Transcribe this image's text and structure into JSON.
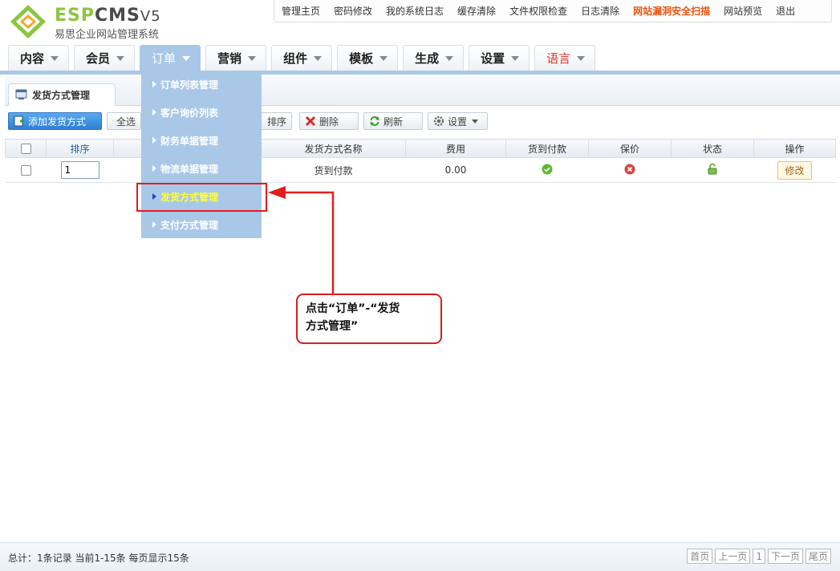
{
  "brand": {
    "name_part1": "ESP",
    "name_part2": "CMS",
    "version": "V5",
    "subtitle": "易思企业网站管理系统"
  },
  "topnav": [
    "管理主页",
    "密码修改",
    "我的系统日志",
    "缓存清除",
    "文件权限检查",
    "日志清除",
    "网站漏洞安全扫描",
    "网站预览",
    "退出"
  ],
  "mainnav": [
    "内容",
    "会员",
    "订单",
    "营销",
    "组件",
    "模板",
    "生成",
    "设置",
    "语言"
  ],
  "dropdown": [
    "订单列表管理",
    "客户询价列表",
    "财务单据管理",
    "物流单据管理",
    "发货方式管理",
    "支付方式管理"
  ],
  "page_tab": "发货方式管理",
  "toolbar": {
    "add": "添加发货方式",
    "select_all": "全选",
    "sort": "排序",
    "delete": "删除",
    "refresh": "刷新",
    "settings": "设置"
  },
  "table": {
    "headers": [
      "排序",
      "发货方式名称",
      "费用",
      "货到付款",
      "保价",
      "状态",
      "操作"
    ],
    "rows": [
      {
        "sort": "1",
        "name": "货到付款",
        "fee": "0.00",
        "edit": "修改"
      }
    ]
  },
  "callout": {
    "line1": "点击“订单”-“发货",
    "line2": "方式管理”"
  },
  "footer": {
    "summary": "总计：1条记录 当前1-15条 每页显示15条",
    "pager": [
      "首页",
      "上一页",
      "1",
      "下一页",
      "尾页"
    ]
  },
  "colors": {
    "accent_blue": "#a9c8e8",
    "hot_link": "#e8530f",
    "callout_red": "#d81e1e"
  }
}
